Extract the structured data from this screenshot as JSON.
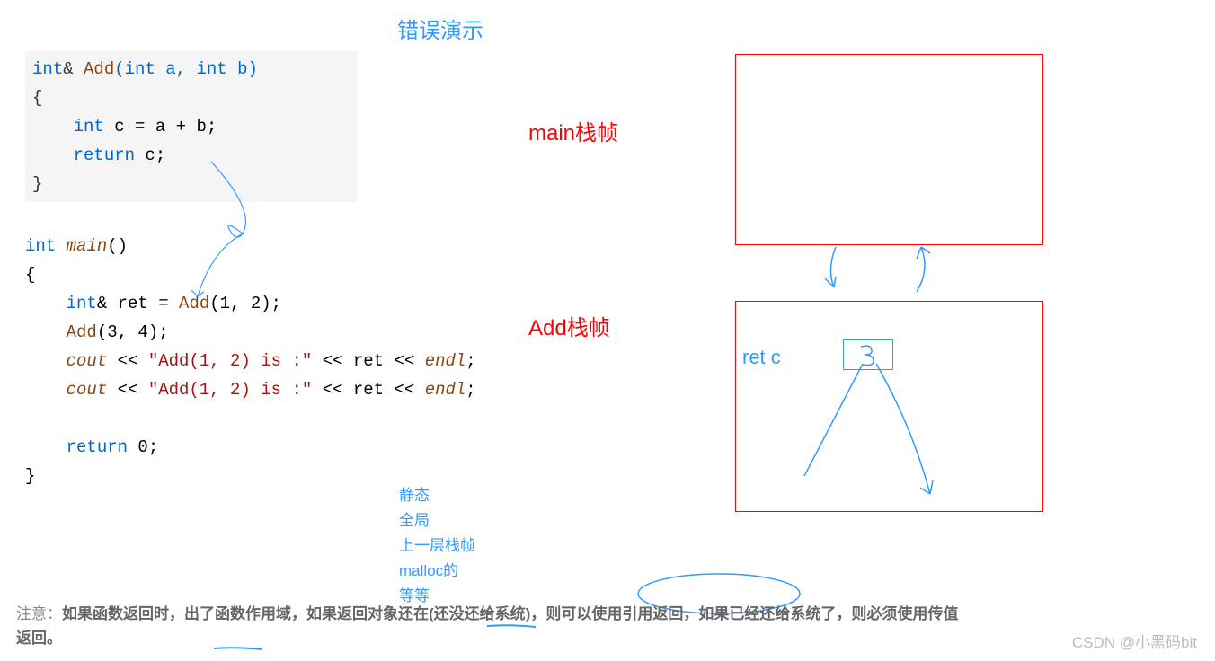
{
  "title": "错误演示",
  "code": {
    "add_sig_type": "int",
    "add_sig_amp": "&",
    "add_sig_name": "Add",
    "add_sig_params": "(int a, int b)",
    "add_body_open": "{",
    "add_body_line1a": "int",
    "add_body_line1b": " c = a + b;",
    "add_body_line2a": "return",
    "add_body_line2b": " c;",
    "add_body_close": "}",
    "main_sig_type": "int",
    "main_sig_name": "main",
    "main_sig_paren": "()",
    "main_open": "{",
    "main_l1a": "int",
    "main_l1b": "& ret = ",
    "main_l1c": "Add",
    "main_l1d": "(1, 2);",
    "main_l2a": "Add",
    "main_l2b": "(3, 4);",
    "main_l3a": "cout",
    "main_l3b": " << ",
    "main_l3c": "\"Add(1, 2) is :\"",
    "main_l3d": " << ret << ",
    "main_l3e": "endl",
    "main_l3f": ";",
    "main_l4a": "cout",
    "main_l4b": " << ",
    "main_l4c": "\"Add(1, 2) is :\"",
    "main_l4d": " << ret << ",
    "main_l4e": "endl",
    "main_l4f": ";",
    "main_ret_a": "return",
    "main_ret_b": " 0;",
    "main_close": "}"
  },
  "labels": {
    "main_frame": "main栈帧",
    "add_frame": "Add栈帧",
    "ret_c": "ret  c"
  },
  "annotations": {
    "item1": "静态",
    "item2": "全局",
    "item3": "上一层栈帧",
    "item4": "malloc的",
    "item5": "等等"
  },
  "note": {
    "prefix": "注意：",
    "bold": "如果函数返回时，出了函数作用域，如果返回对象还在(还没还给系统)，则可以使用引用返回，如果已经还给系统了，则必须使用传值返回。"
  },
  "watermark": "CSDN @小黑码bit"
}
